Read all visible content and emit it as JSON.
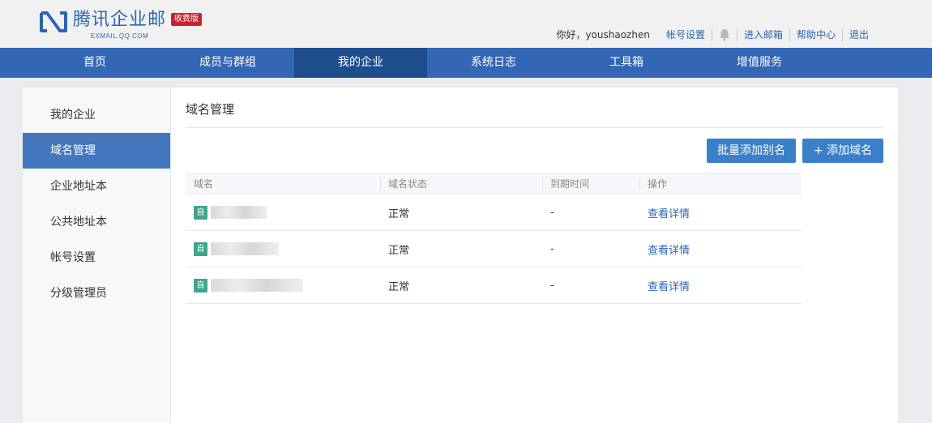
{
  "brand": {
    "name": "腾讯企业邮",
    "domain_text": "EXMAIL.QQ.COM",
    "edition": "收费版",
    "color": "#2a66b0",
    "badge_color": "#c8242f"
  },
  "top_links": {
    "greeting": "你好，youshaozhen",
    "account_settings": "帐号设置",
    "bell_icon": "bell-icon",
    "enter_mailbox": "进入邮箱",
    "help_center": "帮助中心",
    "logout": "退出"
  },
  "nav": {
    "items": [
      {
        "label": "首页"
      },
      {
        "label": "成员与群组"
      },
      {
        "label": "我的企业"
      },
      {
        "label": "系统日志"
      },
      {
        "label": "工具箱"
      },
      {
        "label": "增值服务"
      }
    ],
    "active_index": 2,
    "color": "#3366b4"
  },
  "sidebar": {
    "items": [
      {
        "label": "我的企业"
      },
      {
        "label": "域名管理"
      },
      {
        "label": "企业地址本"
      },
      {
        "label": "公共地址本"
      },
      {
        "label": "帐号设置"
      },
      {
        "label": "分级管理员"
      }
    ],
    "active_index": 1
  },
  "main": {
    "title": "域名管理",
    "bulk_alias_button": "批量添加别名",
    "add_domain_button": "+  添加域名",
    "table": {
      "columns": [
        "域名",
        "域名状态",
        "到期时间",
        "操作"
      ],
      "rows": [
        {
          "tag": "自",
          "status": "正常",
          "expiry": "-",
          "action": "查看详情"
        },
        {
          "tag": "自",
          "status": "正常",
          "expiry": "-",
          "action": "查看详情"
        },
        {
          "tag": "自",
          "status": "正常",
          "expiry": "-",
          "action": "查看详情"
        }
      ]
    }
  }
}
